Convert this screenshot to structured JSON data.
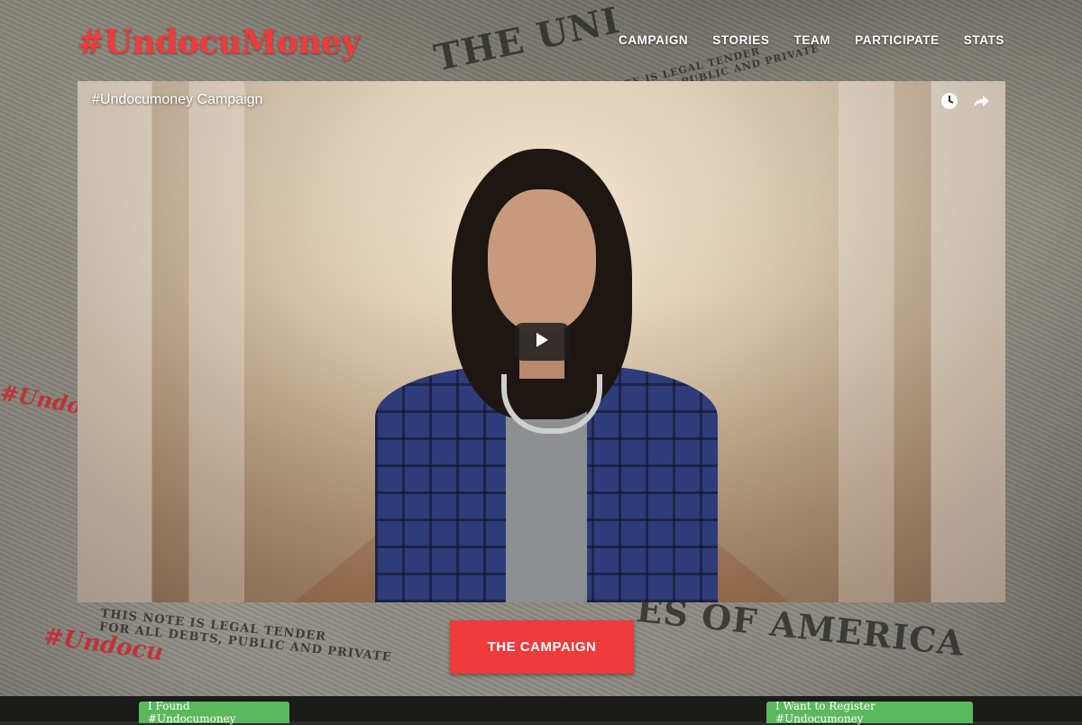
{
  "logo": "#UndocuMoney",
  "nav": [
    "CAMPAIGN",
    "STORIES",
    "TEAM",
    "PARTICIPATE",
    "STATS"
  ],
  "video": {
    "title": "#Undocumoney Campaign",
    "icons": [
      "clock-icon",
      "share-icon",
      "play-icon"
    ]
  },
  "background_text": {
    "note_left": "THIS NOTE IS LEGAL TENDER\nFOR ALL DEBTS, PUBLIC AND PRIVATE",
    "note_top": "THIS NOTE IS LEGAL TENDER\nFOR ALL DEBTS, PUBLIC AND PRIVATE",
    "states_bottom": "ES OF AMERICA",
    "states_top": "THE UNI",
    "stamp": "#Undocu",
    "stamp_left": "#Undo"
  },
  "cta": "THE CAMPAIGN",
  "buttons": {
    "found": "I Found #Undocumoney",
    "register": "I Want to Register #Undocumoney"
  },
  "colors": {
    "accent": "#ef3b3b",
    "logo": "#f23a3a",
    "green": "#5cb85c"
  }
}
